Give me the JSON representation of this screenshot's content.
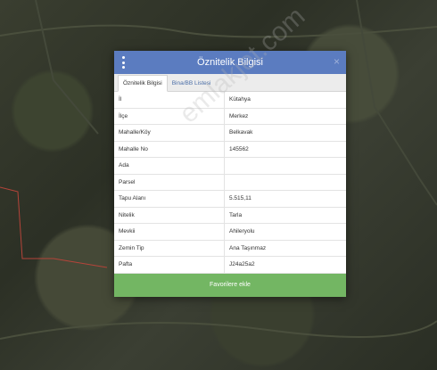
{
  "modal": {
    "title": "Öznitelik Bilgisi",
    "close_glyph": "×",
    "tabs": [
      {
        "label": "Öznitelik Bilgisi",
        "active": true
      },
      {
        "label": "Bina/BB Listesi",
        "active": false
      }
    ],
    "rows": [
      {
        "key": "İl",
        "value": "Kütahya"
      },
      {
        "key": "İlçe",
        "value": "Merkez"
      },
      {
        "key": "Mahalle/Köy",
        "value": "Belkavak"
      },
      {
        "key": "Mahalle No",
        "value": "145562"
      },
      {
        "key": "Ada",
        "value": ""
      },
      {
        "key": "Parsel",
        "value": ""
      },
      {
        "key": "Tapu Alanı",
        "value": "5.515,11"
      },
      {
        "key": "Nitelik",
        "value": "Tarla"
      },
      {
        "key": "Mevkii",
        "value": "Ahileryolu"
      },
      {
        "key": "Zemin Tip",
        "value": "Ana Taşınmaz"
      },
      {
        "key": "Pafta",
        "value": "J24a25a2"
      }
    ],
    "button_label": "Favorilere ekle"
  },
  "watermark": "emlakjet.com",
  "colors": {
    "header": "#5b7cc0",
    "button": "#73b663",
    "tab_link": "#4c6fa8",
    "parcel_line": "#b5443a"
  },
  "icons": {
    "menu": "vertical-dots-icon",
    "close": "close-icon"
  }
}
